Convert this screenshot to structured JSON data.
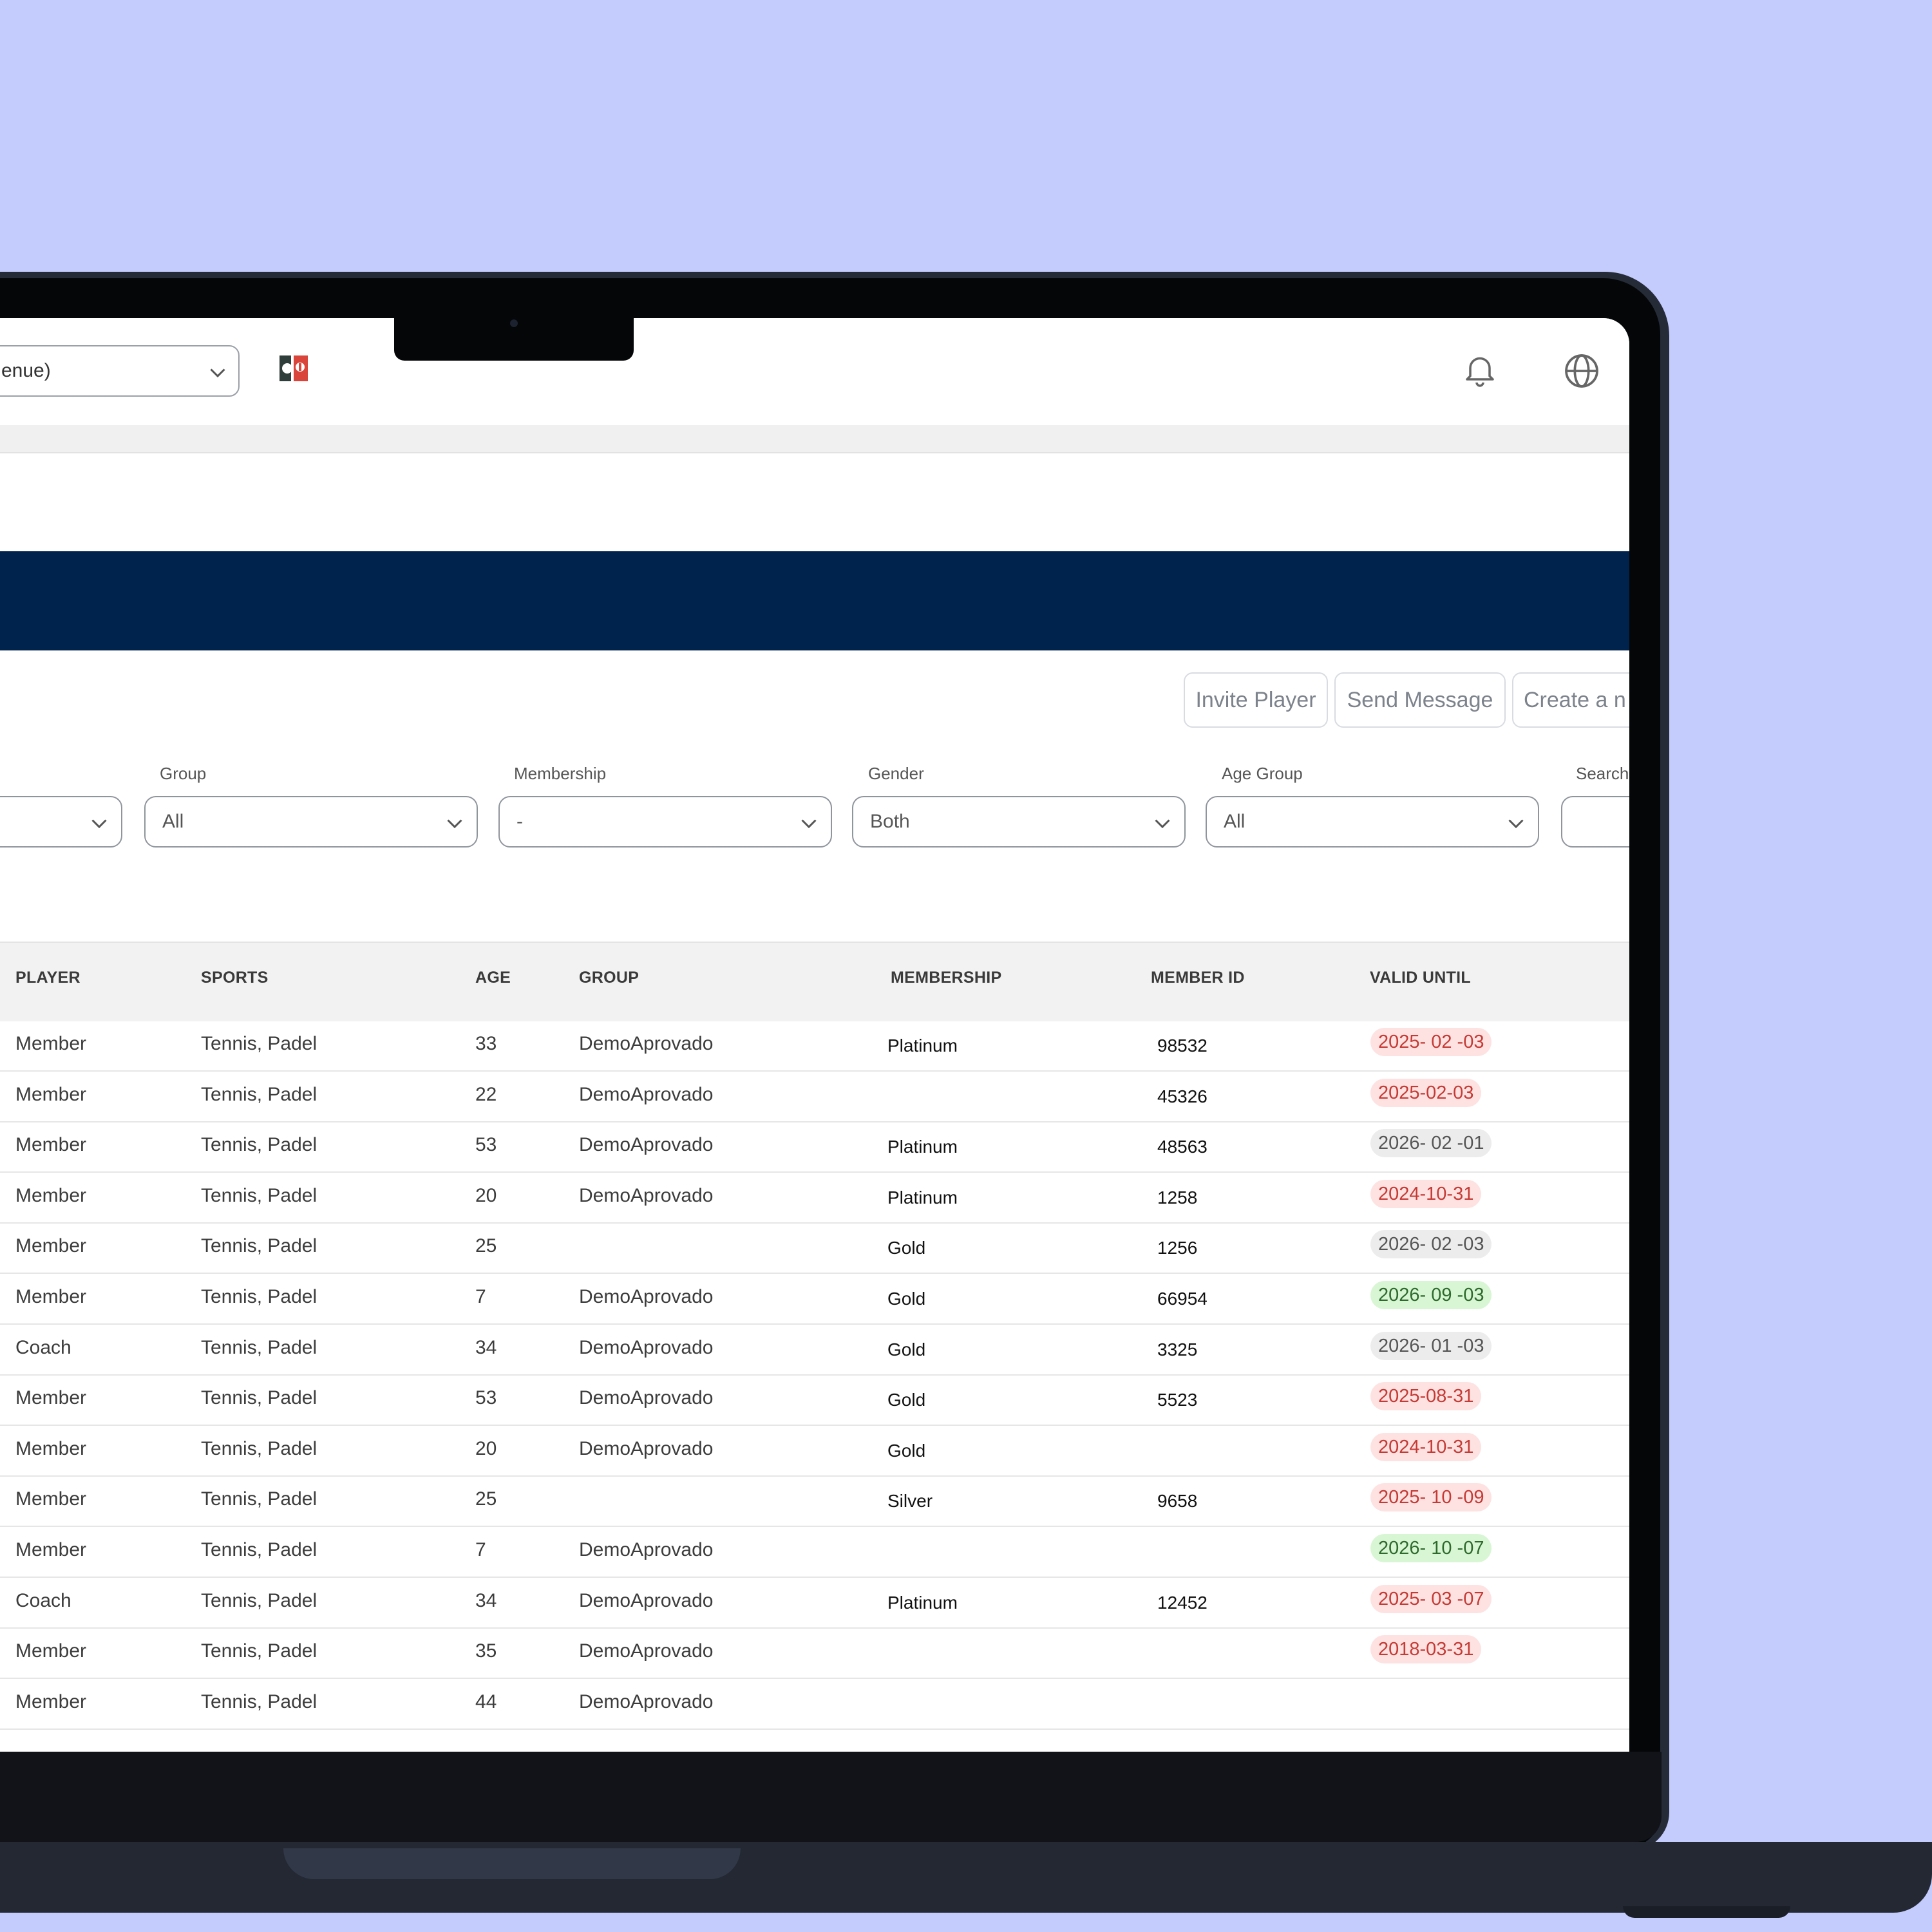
{
  "header": {
    "venue_select_value": "enue)"
  },
  "actions": {
    "invite_player": "Invite Player",
    "send_message": "Send Message",
    "create": "Create a n"
  },
  "filters": {
    "group": {
      "label": "Group",
      "value": "All"
    },
    "membership": {
      "label": "Membership",
      "value": "-"
    },
    "gender": {
      "label": "Gender",
      "value": "Both"
    },
    "age_group": {
      "label": "Age Group",
      "value": "All"
    },
    "search": {
      "label": "Search"
    }
  },
  "table": {
    "columns": [
      "PLAYER",
      "SPORTS",
      "AGE",
      "GROUP",
      "MEMBERSHIP",
      "MEMBER ID",
      "VALID UNTIL"
    ],
    "rows": [
      {
        "player": "Member",
        "sports": "Tennis, Padel",
        "age": "33",
        "group": "DemoAprovado",
        "membership": "Platinum",
        "member_id": "98532",
        "valid_until": "2025- 02 -03",
        "status": "red"
      },
      {
        "player": "Member",
        "sports": "Tennis, Padel",
        "age": "22",
        "group": "DemoAprovado",
        "membership": "",
        "member_id": "45326",
        "valid_until": "2025-02-03",
        "status": "red"
      },
      {
        "player": "Member",
        "sports": "Tennis, Padel",
        "age": "53",
        "group": "DemoAprovado",
        "membership": "Platinum",
        "member_id": "48563",
        "valid_until": "2026- 02 -01",
        "status": "gray"
      },
      {
        "player": "Member",
        "sports": "Tennis, Padel",
        "age": "20",
        "group": "DemoAprovado",
        "membership": "Platinum",
        "member_id": "1258",
        "valid_until": "2024-10-31",
        "status": "red"
      },
      {
        "player": "Member",
        "sports": "Tennis, Padel",
        "age": "25",
        "group": "",
        "membership": "Gold",
        "member_id": "1256",
        "valid_until": "2026- 02 -03",
        "status": "gray"
      },
      {
        "player": "Member",
        "sports": "Tennis, Padel",
        "age": "7",
        "group": "DemoAprovado",
        "membership": "Gold",
        "member_id": "66954",
        "valid_until": "2026- 09 -03",
        "status": "green"
      },
      {
        "player": "Coach",
        "sports": "Tennis, Padel",
        "age": "34",
        "group": "DemoAprovado",
        "membership": "Gold",
        "member_id": "3325",
        "valid_until": "2026- 01 -03",
        "status": "gray"
      },
      {
        "player": "Member",
        "sports": "Tennis, Padel",
        "age": "53",
        "group": "DemoAprovado",
        "membership": "Gold",
        "member_id": "5523",
        "valid_until": "2025-08-31",
        "status": "red"
      },
      {
        "player": "Member",
        "sports": "Tennis, Padel",
        "age": "20",
        "group": "DemoAprovado",
        "membership": "Gold",
        "member_id": "",
        "valid_until": "2024-10-31",
        "status": "red"
      },
      {
        "player": "Member",
        "sports": "Tennis, Padel",
        "age": "25",
        "group": "",
        "membership": "Silver",
        "member_id": "9658",
        "valid_until": "2025- 10 -09",
        "status": "red"
      },
      {
        "player": "Member",
        "sports": "Tennis, Padel",
        "age": "7",
        "group": "DemoAprovado",
        "membership": "",
        "member_id": "",
        "valid_until": "2026- 10 -07",
        "status": "green"
      },
      {
        "player": "Coach",
        "sports": "Tennis, Padel",
        "age": "34",
        "group": "DemoAprovado",
        "membership": "Platinum",
        "member_id": "12452",
        "valid_until": "2025- 03 -07",
        "status": "red"
      },
      {
        "player": "Member",
        "sports": "Tennis, Padel",
        "age": "35",
        "group": "DemoAprovado",
        "membership": "",
        "member_id": "",
        "valid_until": "2018-03-31",
        "status": "red"
      },
      {
        "player": "Member",
        "sports": "Tennis, Padel",
        "age": "44",
        "group": "DemoAprovado",
        "membership": "",
        "member_id": "",
        "valid_until": "",
        "status": ""
      }
    ]
  },
  "colors": {
    "background": "#c4cbfd",
    "navy_band": "#00234d",
    "expired_red": "#c53a35",
    "active_green": "#2d6a2c"
  }
}
